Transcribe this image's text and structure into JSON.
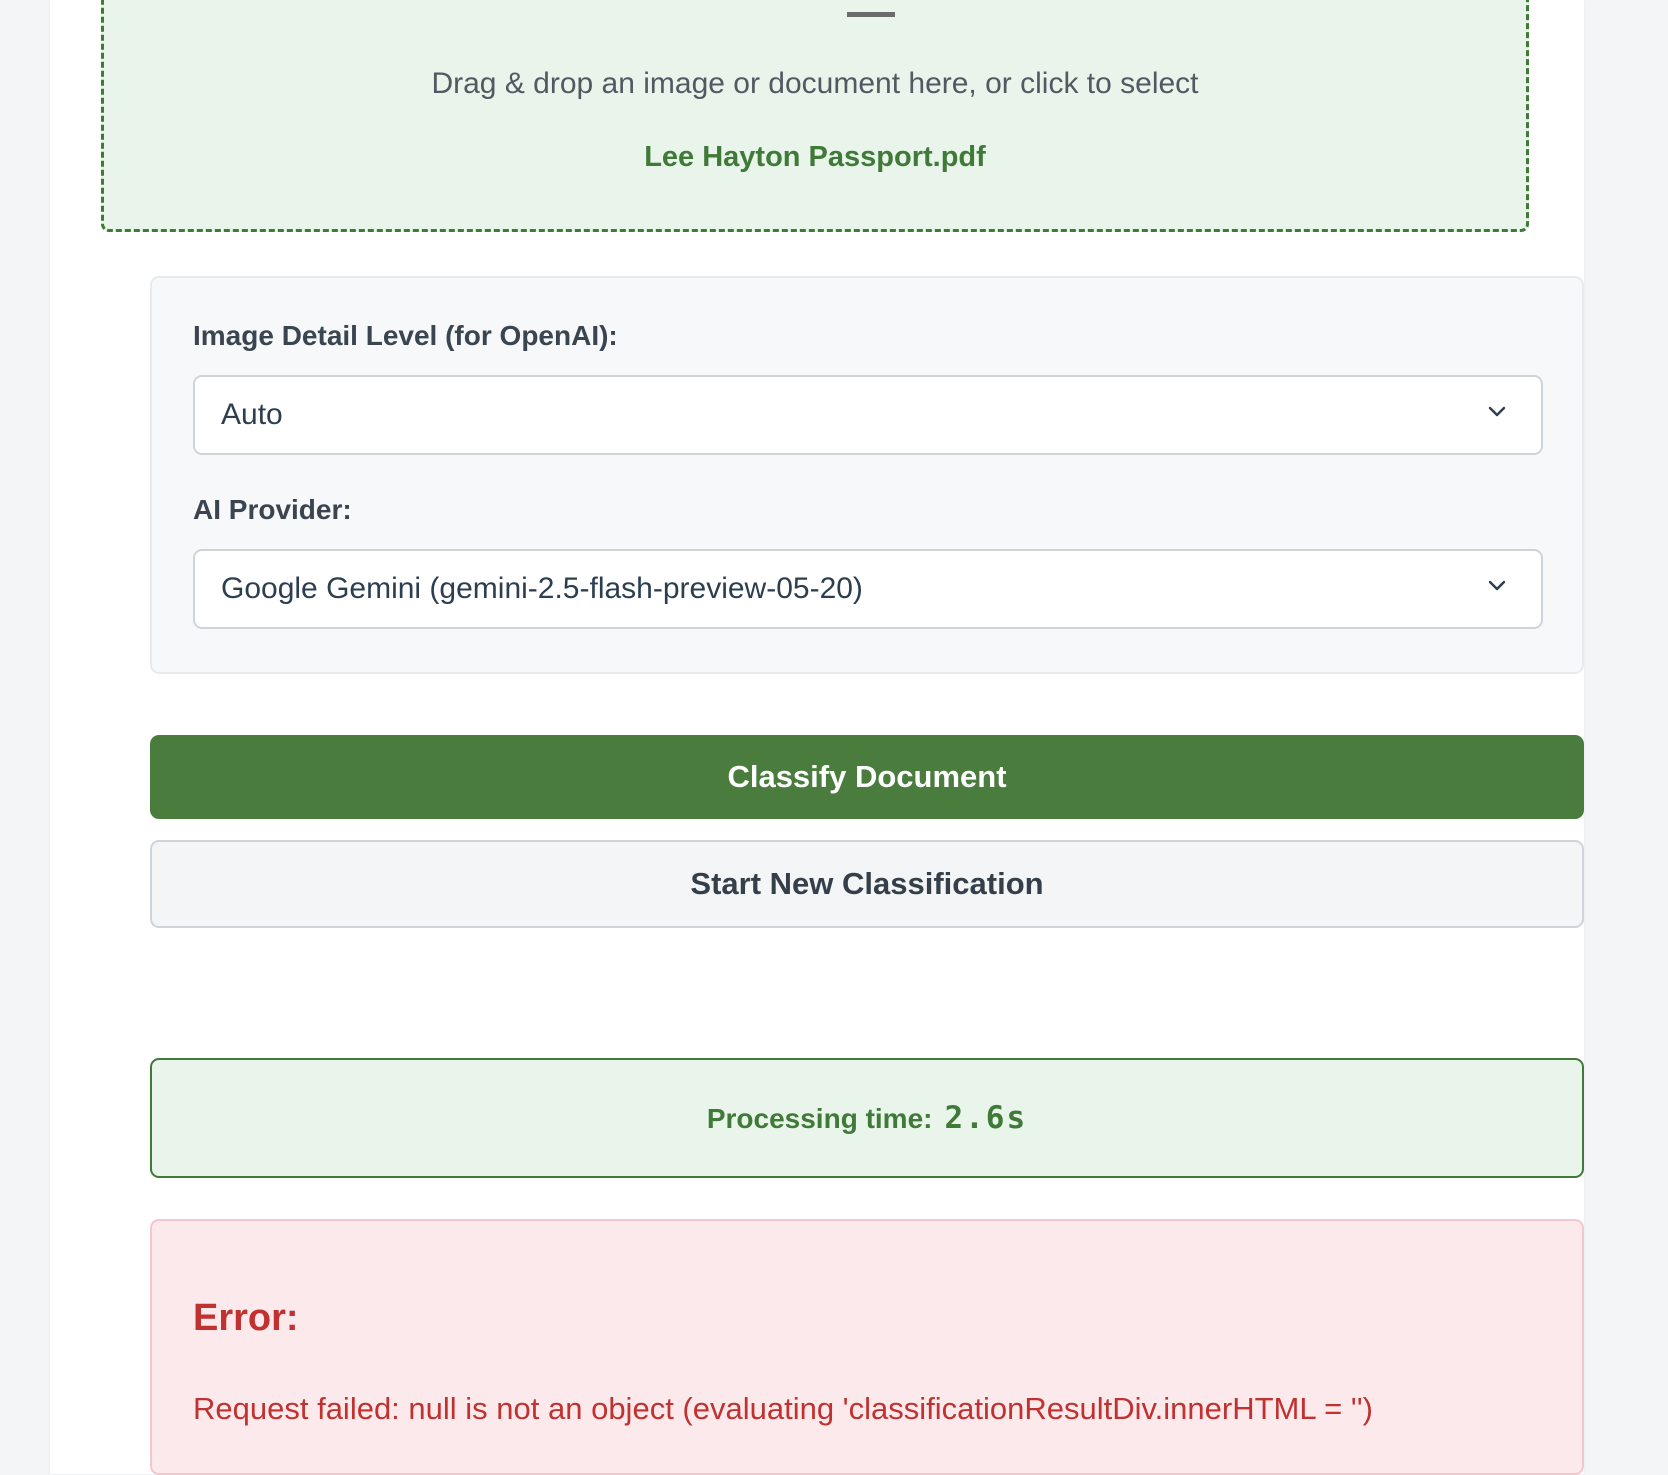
{
  "dropzone": {
    "icon": "upload-icon",
    "instructions": "Drag & drop an image or document here, or click to select",
    "selected_file": "Lee Hayton Passport.pdf"
  },
  "options": {
    "detail_label": "Image Detail Level (for OpenAI):",
    "detail_value": "Auto",
    "provider_label": "AI Provider:",
    "provider_value": "Google Gemini (gemini-2.5-flash-preview-05-20)"
  },
  "actions": {
    "classify_label": "Classify Document",
    "new_label": "Start New Classification"
  },
  "timing": {
    "label": "Processing time:",
    "value": "2.6s"
  },
  "error": {
    "title": "Error:",
    "message": "Request failed: null is not an object (evaluating 'classificationResultDiv.innerHTML = '')"
  },
  "colors": {
    "brand_green": "#4a7c3d",
    "success_bg": "#e9f4ea",
    "error_text": "#c0322f",
    "error_bg": "#fbe9ec"
  }
}
